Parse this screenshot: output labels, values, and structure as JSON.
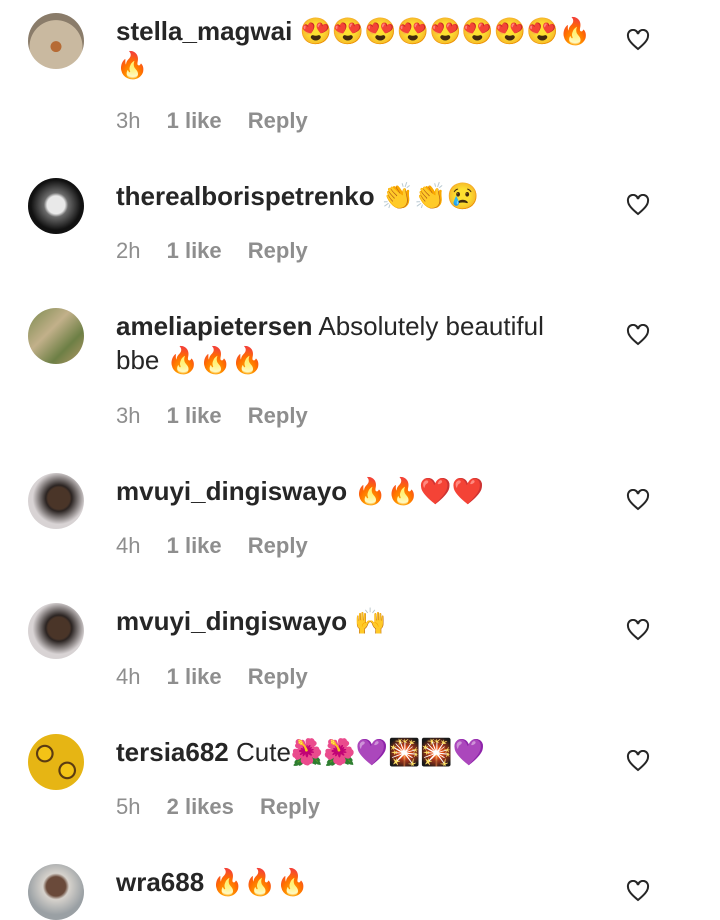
{
  "comments": [
    {
      "username": "stella_magwai",
      "text": "😍😍😍😍😍😍😍😍🔥🔥",
      "time": "3h",
      "likes": "1 like",
      "reply": "Reply"
    },
    {
      "username": "therealborispetrenko",
      "text": "👏👏😢",
      "time": "2h",
      "likes": "1 like",
      "reply": "Reply"
    },
    {
      "username": "ameliapietersen",
      "text": "Absolutely beautiful bbe 🔥🔥🔥",
      "time": "3h",
      "likes": "1 like",
      "reply": "Reply"
    },
    {
      "username": "mvuyi_dingiswayo",
      "text": "🔥🔥❤️❤️",
      "time": "4h",
      "likes": "1 like",
      "reply": "Reply"
    },
    {
      "username": "mvuyi_dingiswayo",
      "text": "🙌",
      "time": "4h",
      "likes": "1 like",
      "reply": "Reply"
    },
    {
      "username": "tersia682",
      "text": "Cute🌺🌺💜🎇🎇💜",
      "time": "5h",
      "likes": "2 likes",
      "reply": "Reply"
    },
    {
      "username": "wra688",
      "text": "🔥🔥🔥",
      "time": "",
      "likes": "",
      "reply": ""
    }
  ],
  "colors": {
    "text": "#262626",
    "meta": "#8e8e8e",
    "heart_outline": "#262626"
  },
  "icons": {
    "like": "heart-outline-icon"
  }
}
